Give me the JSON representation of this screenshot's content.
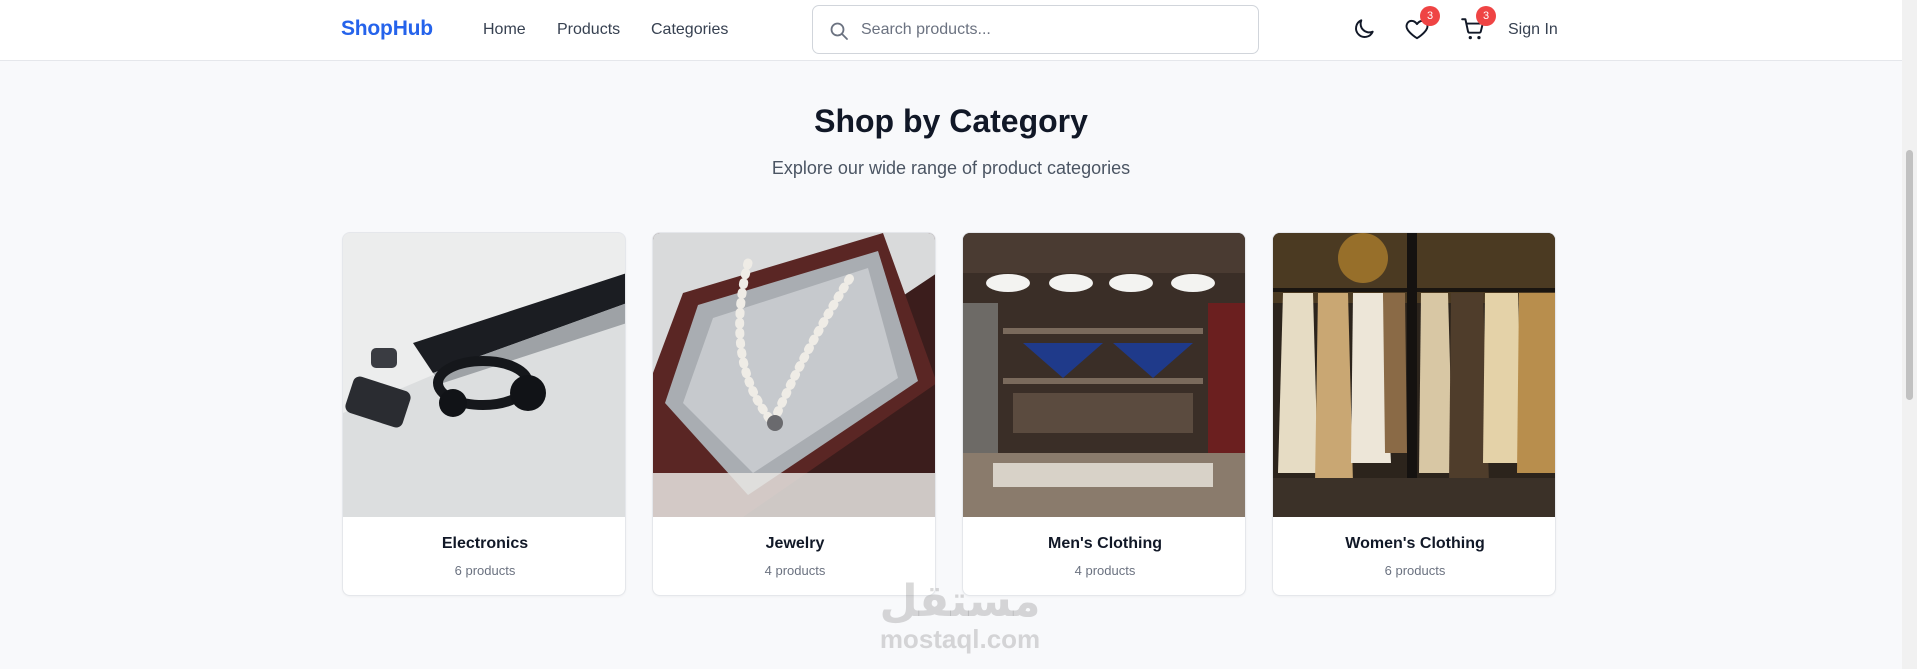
{
  "header": {
    "logo": "ShopHub",
    "nav": [
      "Home",
      "Products",
      "Categories"
    ],
    "search_placeholder": "Search products...",
    "wishlist_count": "3",
    "cart_count": "3",
    "signin_label": "Sign In"
  },
  "main": {
    "title": "Shop by Category",
    "subtitle": "Explore our wide range of product categories",
    "categories": [
      {
        "name": "Electronics",
        "count": "6 products"
      },
      {
        "name": "Jewelry",
        "count": "4 products"
      },
      {
        "name": "Men's Clothing",
        "count": "4 products"
      },
      {
        "name": "Women's Clothing",
        "count": "6 products"
      }
    ]
  },
  "watermark": {
    "arabic": "مستقل",
    "latin": "mostaql.com"
  },
  "colors": {
    "brand": "#2563eb",
    "badge": "#ef4444",
    "background": "#f8f9fb"
  },
  "icons": [
    "search-icon",
    "moon-icon",
    "heart-icon",
    "cart-icon"
  ]
}
